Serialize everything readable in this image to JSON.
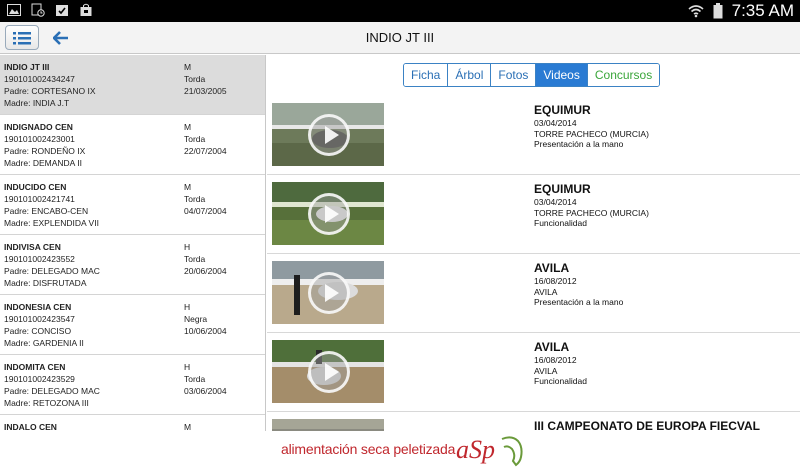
{
  "status_bar": {
    "time": "7:35 AM"
  },
  "header": {
    "title": "INDIO JT III"
  },
  "horses": [
    {
      "name": "INDIO JT III",
      "id": "190101002434247",
      "padre": "Padre: CORTESANO IX",
      "madre": "Madre: INDIA J.T",
      "sexo": "M",
      "capa": "Torda",
      "fecha": "21/03/2005",
      "selected": true
    },
    {
      "name": "INDIGNADO CEN",
      "id": "190101002423001",
      "padre": "Padre: RONDEÑO IX",
      "madre": "Madre: DEMANDA II",
      "sexo": "M",
      "capa": "Torda",
      "fecha": "22/07/2004"
    },
    {
      "name": "INDUCIDO CEN",
      "id": "190101002421741",
      "padre": "Padre: ENCABO-CEN",
      "madre": "Madre: EXPLENDIDA VII",
      "sexo": "M",
      "capa": "Torda",
      "fecha": "04/07/2004"
    },
    {
      "name": "INDIVISA CEN",
      "id": "190101002423552",
      "padre": "Padre: DELEGADO MAC",
      "madre": "Madre: DISFRUTADA",
      "sexo": "H",
      "capa": "Torda",
      "fecha": "20/06/2004"
    },
    {
      "name": "INDONESIA CEN",
      "id": "190101002423547",
      "padre": "Padre: CONCISO",
      "madre": "Madre: GARDENIA II",
      "sexo": "H",
      "capa": "Negra",
      "fecha": "10/06/2004"
    },
    {
      "name": "INDOMITA CEN",
      "id": "190101002423529",
      "padre": "Padre: DELEGADO MAC",
      "madre": "Madre: RETOZONA III",
      "sexo": "H",
      "capa": "Torda",
      "fecha": "03/06/2004"
    },
    {
      "name": "INDALO CEN",
      "id": "",
      "padre": "",
      "madre": "",
      "sexo": "M",
      "capa": "",
      "fecha": ""
    }
  ],
  "tabs": [
    {
      "label": "Ficha"
    },
    {
      "label": "Árbol"
    },
    {
      "label": "Fotos"
    },
    {
      "label": "Videos",
      "active": true
    },
    {
      "label": "Concursos"
    }
  ],
  "videos": [
    {
      "title": "EQUIMUR",
      "date": "03/04/2014",
      "place": "TORRE PACHECO (MURCIA)",
      "category": "Presentación a la mano"
    },
    {
      "title": "EQUIMUR",
      "date": "03/04/2014",
      "place": "TORRE PACHECO (MURCIA)",
      "category": "Funcionalidad"
    },
    {
      "title": "AVILA",
      "date": "16/08/2012",
      "place": "AVILA",
      "category": "Presentación a la mano"
    },
    {
      "title": "AVILA",
      "date": "16/08/2012",
      "place": "AVILA",
      "category": "Funcionalidad"
    },
    {
      "title": "III CAMPEONATO DE EUROPA FIECVAL",
      "date": "",
      "place": "",
      "category": ""
    }
  ],
  "banner": {
    "text": "alimentación seca peletizada",
    "logo": "aSp"
  }
}
